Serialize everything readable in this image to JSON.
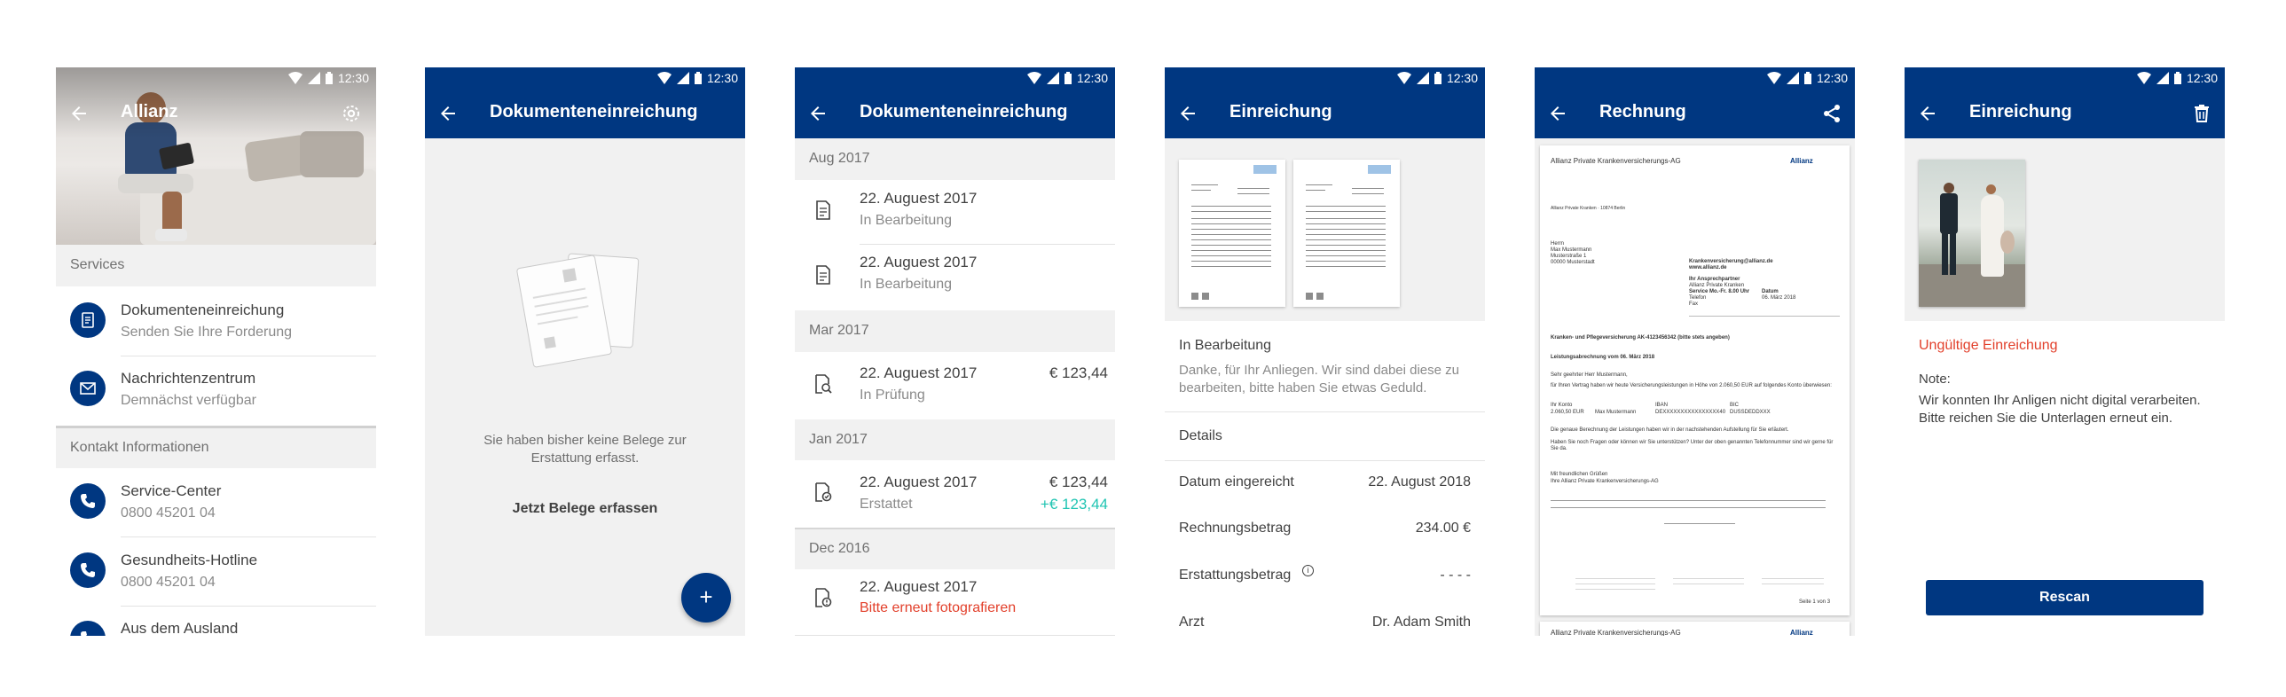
{
  "status": {
    "time": "12:30"
  },
  "colors": {
    "primary": "#003781",
    "teal": "#1fc4b2",
    "error": "#e23f2a"
  },
  "screen1": {
    "title": "Allianz",
    "services_header": "Services",
    "services": [
      {
        "title": "Dokumenteneinreichung",
        "subtitle": "Senden Sie Ihre Forderung",
        "icon": "document-icon"
      },
      {
        "title": "Nachrichtenzentrum",
        "subtitle": "Demnächst verfügbar",
        "icon": "mail-icon"
      }
    ],
    "contact_header": "Kontakt Informationen",
    "contacts": [
      {
        "title": "Service-Center",
        "subtitle": "0800 45201 04",
        "icon": "phone-icon"
      },
      {
        "title": "Gesundheits-Hotline",
        "subtitle": "0800 45201 04",
        "icon": "phone-icon"
      },
      {
        "title": "Aus dem Ausland",
        "icon": "phone-icon"
      }
    ]
  },
  "screen2": {
    "title": "Dokumenteneinreichung",
    "empty_text": "Sie haben bisher keine Belege zur Erstattung erfasst.",
    "cta": "Jetzt Belege erfassen",
    "fab": "+"
  },
  "screen3": {
    "title": "Dokumenteneinreichung",
    "groups": [
      {
        "month": "Aug 2017",
        "items": [
          {
            "date": "22. Auguest 2017",
            "status": "In Bearbeitung"
          },
          {
            "date": "22. Auguest 2017",
            "status": "In Bearbeitung"
          }
        ]
      },
      {
        "month": "Mar 2017",
        "items": [
          {
            "date": "22. Auguest 2017",
            "status": "In Prüfung",
            "amount": "€ 123,44"
          }
        ]
      },
      {
        "month": "Jan 2017",
        "items": [
          {
            "date": "22. Auguest 2017",
            "status": "Erstattet",
            "amount": "€ 123,44",
            "refund": "+€ 123,44"
          }
        ]
      },
      {
        "month": "Dec 2016",
        "items": [
          {
            "date": "22. Auguest 2017",
            "status": "Bitte erneut fotografieren"
          }
        ]
      }
    ]
  },
  "screen4": {
    "title": "Einreichung",
    "status_title": "In Bearbeitung",
    "status_text": "Danke, für Ihr Anliegen. Wir sind dabei diese zu bearbeiten, bitte haben Sie etwas Geduld.",
    "details_header": "Details",
    "details": [
      {
        "label": "Datum eingereicht",
        "value": "22. August 2018"
      },
      {
        "label": "Rechnungsbetrag",
        "value": "234.00 €"
      },
      {
        "label": "Erstattungsbetrag",
        "value": "- - - -"
      },
      {
        "label": "Arzt",
        "value": "Dr. Adam Smith"
      }
    ]
  },
  "screen5": {
    "title": "Rechnung",
    "doc": {
      "company": "Allianz Private Krankenversicherungs-AG",
      "logo": "Allianz",
      "sender_line": "Allianz Private Kranken · 10874 Berlin",
      "recipient": [
        "Herrn",
        "Max Mustermann",
        "Musterstraße 1",
        "00000 Musterstadt"
      ],
      "contact_email": "Krankenversicherung@allianz.de",
      "contact_web": "www.allianz.de",
      "contact_lines": [
        "Ihr Ansprechpartner",
        "Allianz Private Kranken",
        "Service Mo.-Fr. 8.00 Uhr",
        "Telefon",
        "Fax"
      ],
      "date_label": "Datum",
      "date_value": "06. März 2018",
      "subject": "Kranken- und Pflegeversicherung AK-4123456342 (bitte stets angeben)",
      "subject2": "Leistungsabrechnung vom 06. März 2018",
      "greeting": "Sehr geehrter Herr Mustermann,",
      "body": "für Ihren Vertrag haben wir heute Versicherungsleistungen in Höhe von 2.060,50 EUR auf folgendes Konto überwiesen:",
      "payment_label": "Ihr Konto",
      "iban_label": "IBAN",
      "bic_label": "BIC",
      "amount": "2.060,50 EUR",
      "payee": "Max Mustermann",
      "iban": "DEXXXXXXXXXXXXXXXX40",
      "bic": "DUSSDEDDXXX",
      "note1": "Die genaue Berechnung der Leistungen haben wir in der nachstehenden Aufstellung für Sie erläutert.",
      "note2": "Haben Sie noch Fragen oder können wir Sie unterstützen? Unter der oben genannten Telefonnummer sind wir gerne für Sie da.",
      "closing": "Mit freundlichen Grüßen",
      "closing2": "Ihre Allianz Private Krankenversicherungs-AG",
      "page": "Seite 1 von 3"
    }
  },
  "screen6": {
    "title": "Einreichung",
    "error_title": "Ungültige Einreichung",
    "note_label": "Note:",
    "note_text": "Wir konnten Ihr Anligen nicht digital verarbeiten. Bitte reichen Sie die Unterlagen erneut ein.",
    "button": "Rescan"
  }
}
